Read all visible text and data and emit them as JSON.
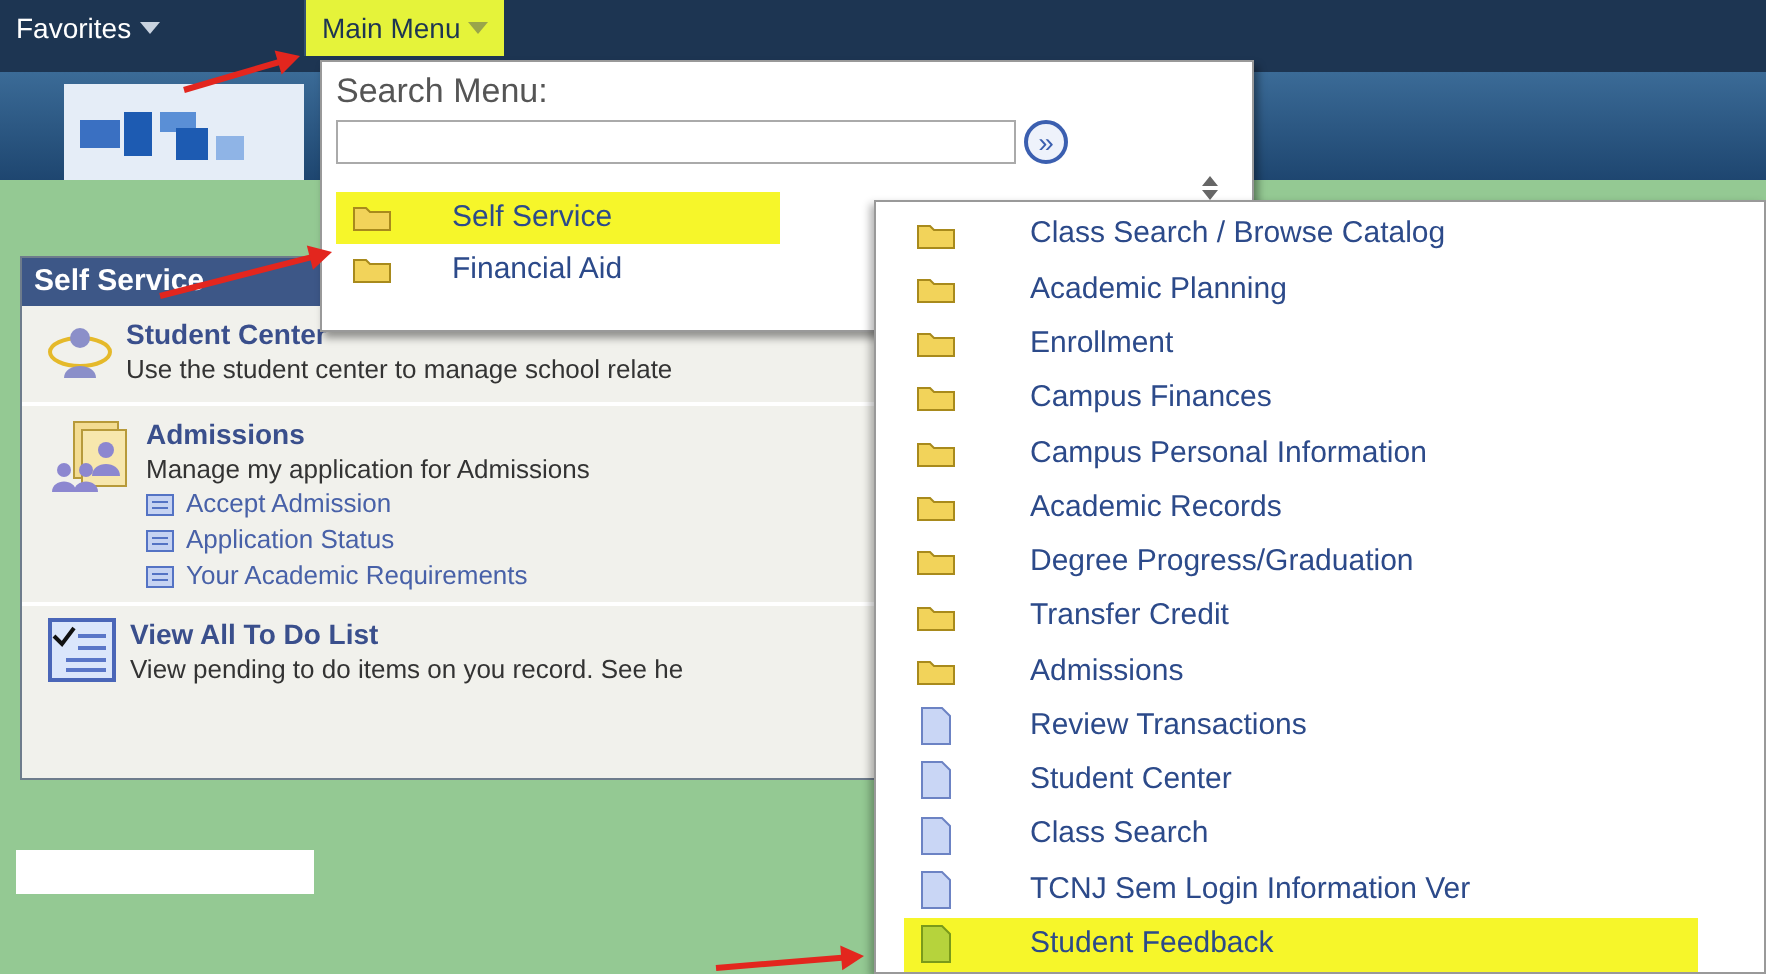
{
  "nav_tabs": [
    {
      "label": "Favorites",
      "selected": false
    },
    {
      "label": "Main Menu",
      "selected": true
    }
  ],
  "pagelet": {
    "title": "Self Service",
    "items": [
      {
        "kind": "student",
        "title": "Student Center",
        "description": "Use the student center to manage school relate"
      },
      {
        "kind": "admissions",
        "title": "Admissions",
        "description": "Manage my application for Admissions",
        "links": [
          "Accept Admission",
          "Application Status",
          "Your Academic Requirements"
        ]
      },
      {
        "kind": "todo",
        "title": "View All To Do List",
        "description": "View pending to do items on you record. See he"
      }
    ]
  },
  "main_menu": {
    "search_label": "Search Menu:",
    "search_button": "»",
    "items": [
      {
        "label": "Self Service",
        "kind": "folder",
        "selected": true
      },
      {
        "label": "Financial Aid",
        "kind": "folder",
        "selected": false
      }
    ]
  },
  "submenu": {
    "items": [
      {
        "label": "Class Search / Browse Catalog",
        "kind": "folder",
        "selected": false
      },
      {
        "label": "Academic Planning",
        "kind": "folder",
        "selected": false
      },
      {
        "label": "Enrollment",
        "kind": "folder",
        "selected": false
      },
      {
        "label": "Campus Finances",
        "kind": "folder",
        "selected": false
      },
      {
        "label": "Campus Personal Information",
        "kind": "folder",
        "selected": false
      },
      {
        "label": "Academic Records",
        "kind": "folder",
        "selected": false
      },
      {
        "label": "Degree Progress/Graduation",
        "kind": "folder",
        "selected": false
      },
      {
        "label": "Transfer Credit",
        "kind": "folder",
        "selected": false
      },
      {
        "label": "Admissions",
        "kind": "folder",
        "selected": false
      },
      {
        "label": "Review Transactions",
        "kind": "page",
        "selected": false
      },
      {
        "label": "Student Center",
        "kind": "page",
        "selected": false
      },
      {
        "label": "Class Search",
        "kind": "page",
        "selected": false
      },
      {
        "label": "TCNJ Sem Login Information Ver",
        "kind": "page",
        "selected": false
      },
      {
        "label": "Student Feedback",
        "kind": "page-green",
        "selected": true
      }
    ]
  }
}
